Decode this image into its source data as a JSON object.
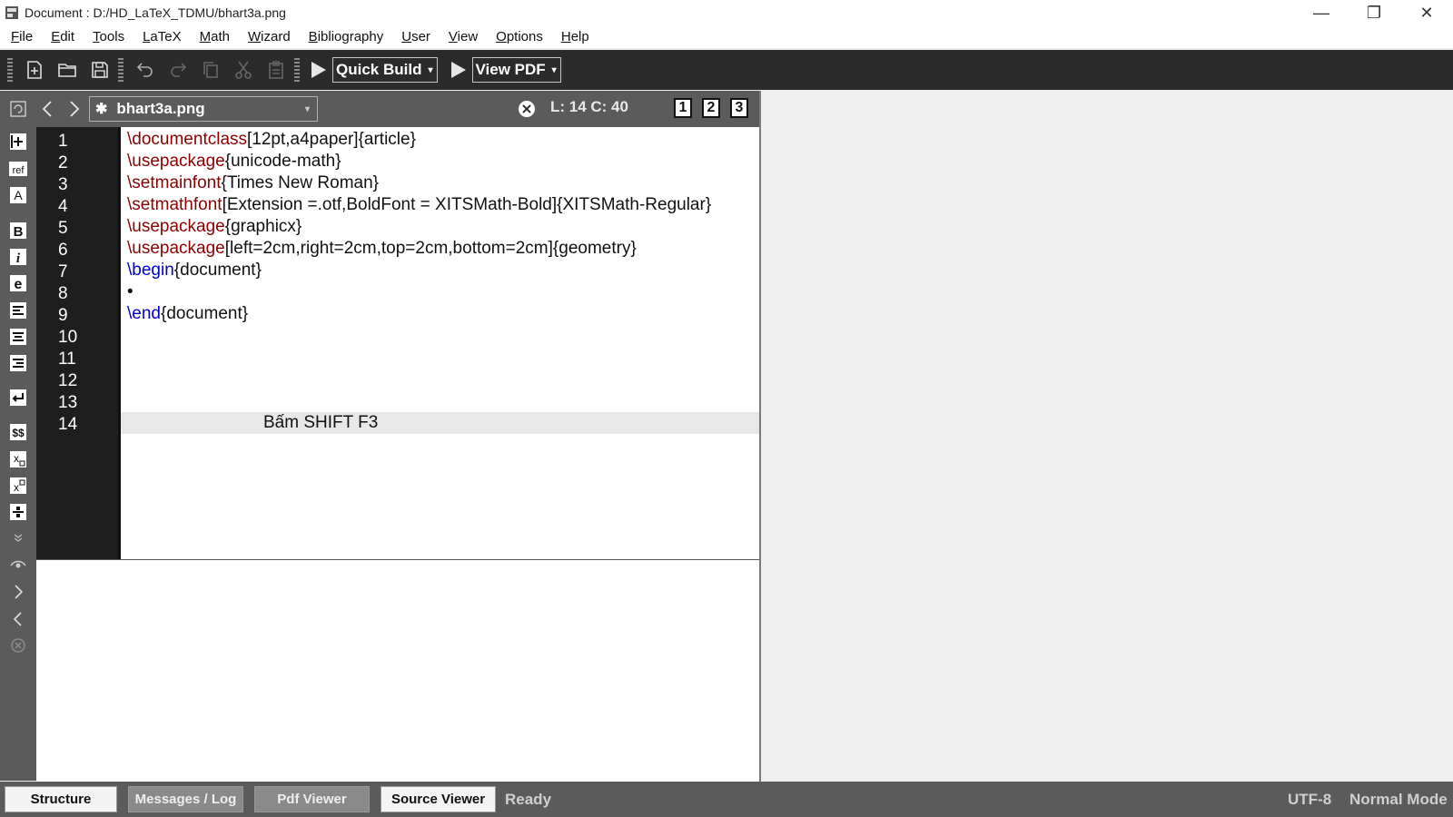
{
  "window": {
    "title": "Document : D:/HD_LaTeX_TDMU/bhart3a.png",
    "controls": {
      "minimize": "—",
      "restore": "❐",
      "close": "✕"
    }
  },
  "menu": {
    "items": [
      {
        "first": "F",
        "rest": "ile"
      },
      {
        "first": "E",
        "rest": "dit"
      },
      {
        "first": "T",
        "rest": "ools"
      },
      {
        "first": "L",
        "rest": "aTeX"
      },
      {
        "first": "M",
        "rest": "ath"
      },
      {
        "first": "W",
        "rest": "izard"
      },
      {
        "first": "B",
        "rest": "ibliography"
      },
      {
        "first": "U",
        "rest": "ser"
      },
      {
        "first": "V",
        "rest": "iew"
      },
      {
        "first": "O",
        "rest": "ptions"
      },
      {
        "first": "H",
        "rest": "elp"
      }
    ]
  },
  "toolbar": {
    "quick_build": "Quick Build",
    "view_pdf": "View PDF",
    "caret": "▾"
  },
  "tabs": {
    "file_name": "bhart3a.png",
    "star": "✱",
    "caret": "▾",
    "cursor": "L: 14 C: 40",
    "views": [
      "1",
      "2",
      "3"
    ]
  },
  "editor": {
    "line_numbers": [
      "1",
      "2",
      "3",
      "4",
      "5",
      "6",
      "7",
      "8",
      "9",
      "10",
      "11",
      "12",
      "13",
      "14"
    ],
    "lines": [
      {
        "cmd": "\\documentclass",
        "arg": "[12pt,a4paper]{article}"
      },
      {
        "cmd": "\\usepackage",
        "arg": "{unicode-math}"
      },
      {
        "cmd": "\\setmainfont",
        "arg": "{Times New Roman}"
      },
      {
        "cmd": "\\setmathfont",
        "arg": "[Extension =.otf,BoldFont = XITSMath-Bold]{XITSMath-Regular}"
      },
      {
        "cmd": "\\usepackage",
        "arg": "{graphicx}"
      },
      {
        "cmd": "\\usepackage",
        "arg": "[left=2cm,right=2cm,top=2cm,bottom=2cm]{geometry}"
      },
      {
        "kw": "\\begin",
        "arg": "{document}"
      },
      {
        "bullet": "•"
      },
      {
        "kw": "\\end",
        "arg": "{document}"
      }
    ],
    "hint_line": "Bấm SHIFT F3"
  },
  "statusbar": {
    "structure": "Structure",
    "messages": "Messages / Log",
    "pdf_viewer": "Pdf Viewer",
    "source_viewer": "Source Viewer",
    "ready": "Ready",
    "encoding": "UTF-8",
    "mode": "Normal Mode"
  }
}
